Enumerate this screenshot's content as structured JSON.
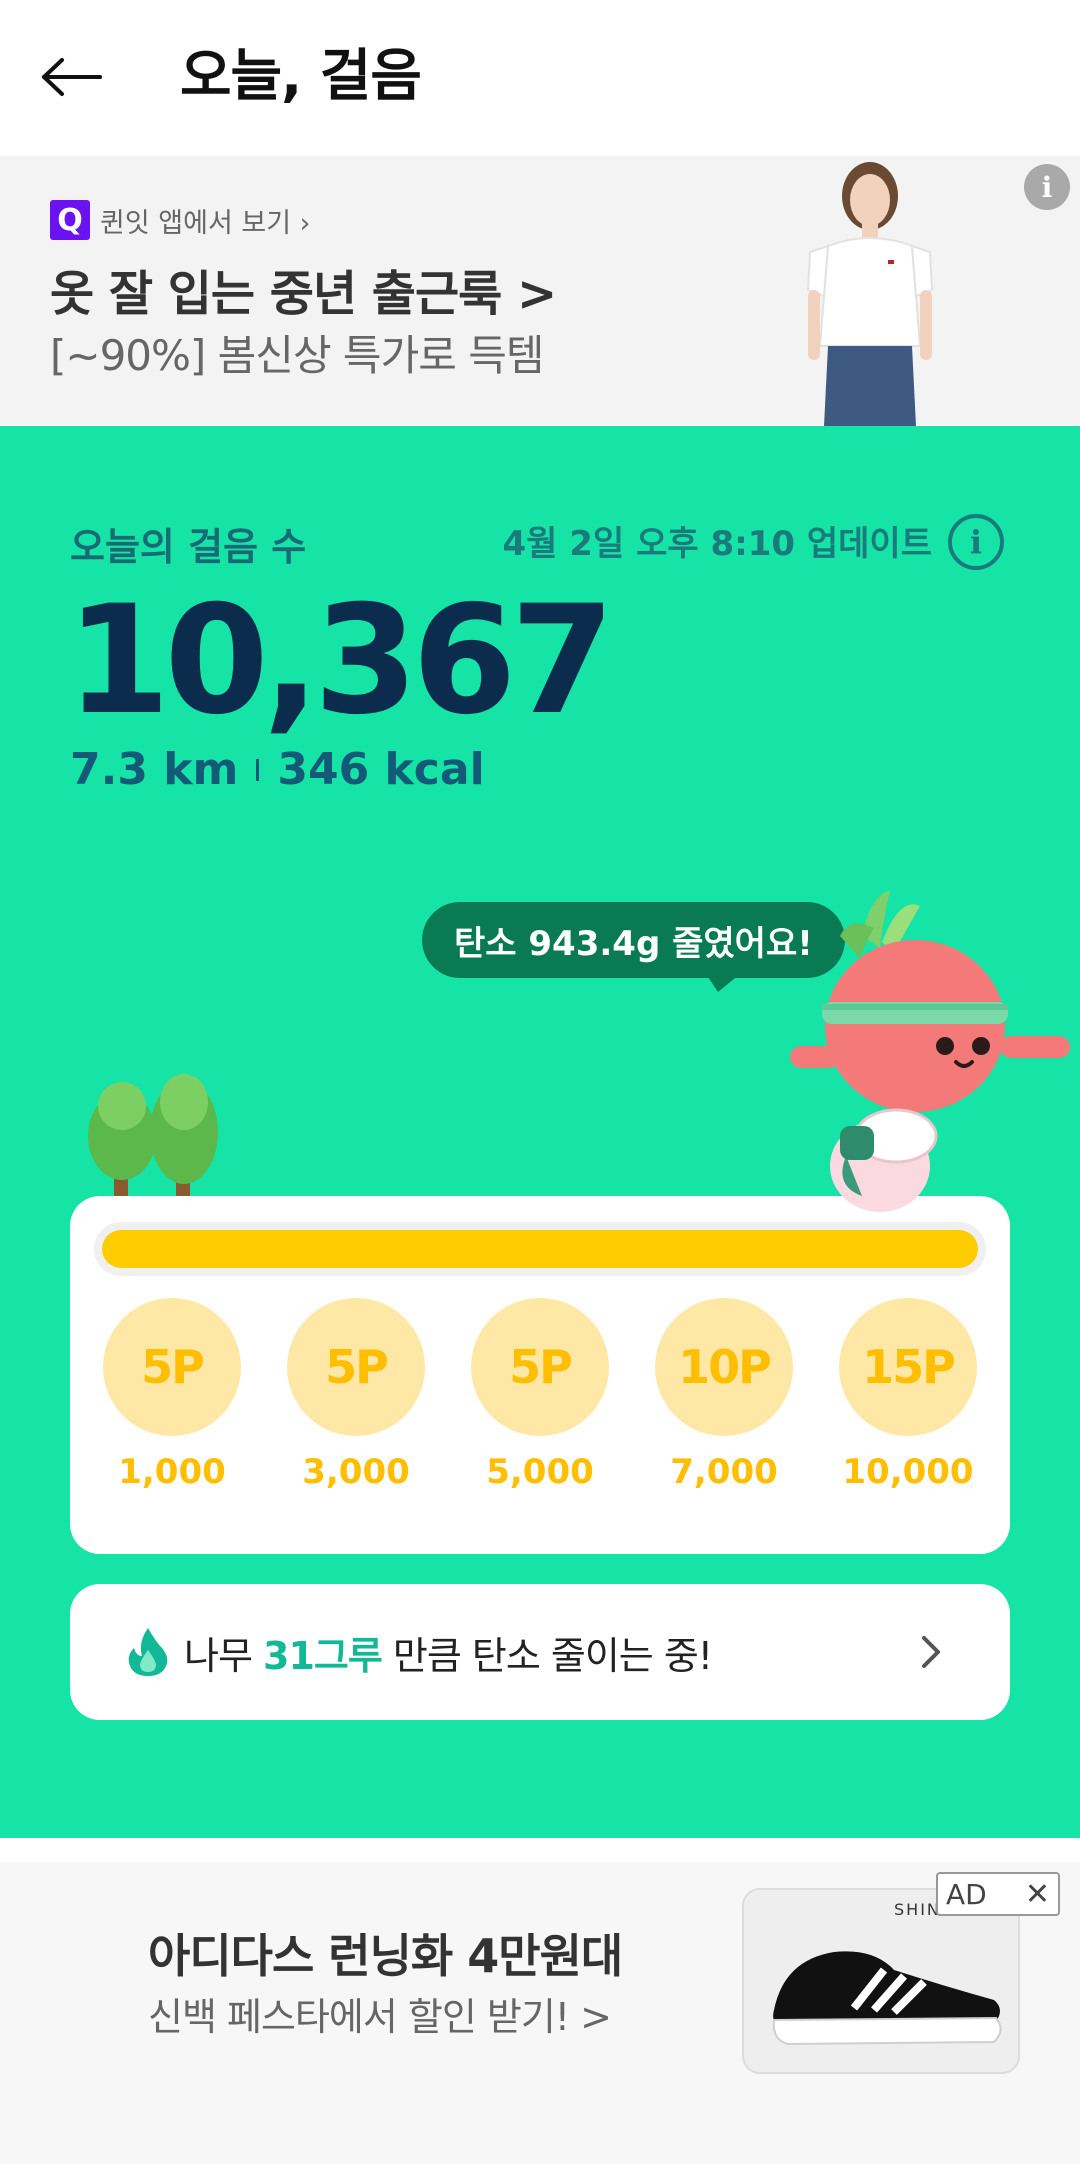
{
  "header": {
    "title": "오늘, 걸음"
  },
  "top_ad": {
    "app_badge": "Q",
    "app_link": "퀸잇 앱에서 보기 ›",
    "headline": "옷 잘 입는 중년 출근룩 >",
    "sub": "[~90%] 봄신상 특가로 득템",
    "info_glyph": "i"
  },
  "steps": {
    "label": "오늘의 걸음 수",
    "update": "4월 2일 오후 8:10 업데이트",
    "info_glyph": "i",
    "count": "10,367",
    "distance": "7.3 km",
    "calories": "346 kcal"
  },
  "bubble": {
    "text": "탄소 943.4g 줄였어요!"
  },
  "progress": {
    "fraction": 1.0,
    "milestones": [
      {
        "points": "5P",
        "steps": "1,000"
      },
      {
        "points": "5P",
        "steps": "3,000"
      },
      {
        "points": "5P",
        "steps": "5,000"
      },
      {
        "points": "10P",
        "steps": "7,000"
      },
      {
        "points": "15P",
        "steps": "10,000"
      }
    ]
  },
  "tree_card": {
    "prefix": "나무 ",
    "highlight": "31그루",
    "suffix": " 만큼 탄소 줄이는 중!"
  },
  "bottom_ad": {
    "headline": "아디다스 런닝화 4만원대",
    "sub": "신백 페스타에서 할인 받기! >",
    "brand": "SHINSEGAE",
    "ad_label": "AD",
    "close_glyph": "✕"
  },
  "colors": {
    "main_bg": "#16e3a6",
    "steps_count": "#0c2c4e",
    "bubble_bg": "#0a7a55",
    "progress_fill": "#ffcc00",
    "milestone_bg": "#ffe7a6",
    "milestone_text": "#ffbf00",
    "highlight": "#13b896",
    "app_badge": "#6a12f0"
  }
}
